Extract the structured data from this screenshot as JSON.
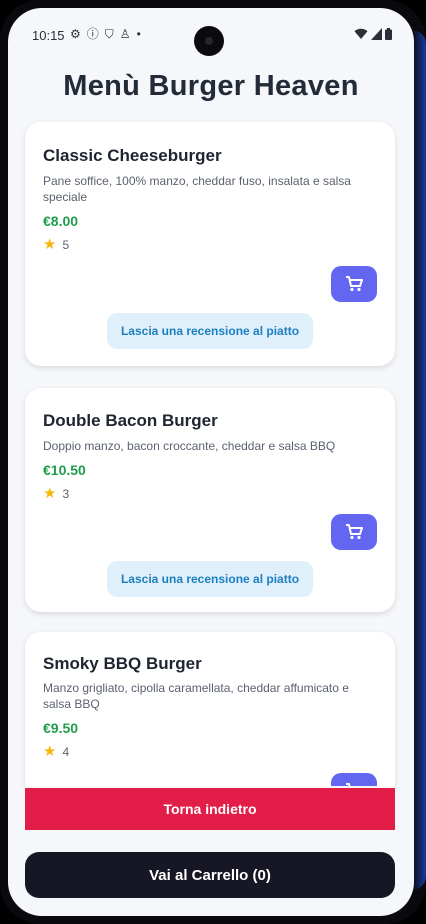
{
  "status_bar": {
    "time": "10:15",
    "left_icons": [
      "settings-icon",
      "info-icon",
      "shield-icon",
      "accessibility-icon",
      "dot-icon"
    ],
    "right_icons": [
      "wifi-icon",
      "signal-icon",
      "battery-icon"
    ]
  },
  "header": {
    "title": "Menù Burger Heaven"
  },
  "menu": {
    "items": [
      {
        "name": "Classic Cheeseburger",
        "description": "Pane soffice, 100% manzo, cheddar fuso, insalata e salsa speciale",
        "price": "€8.00",
        "rating": "5",
        "cart_icon": "cart-icon",
        "review_label": "Lascia una recensione al piatto"
      },
      {
        "name": "Double Bacon Burger",
        "description": "Doppio manzo, bacon croccante, cheddar e salsa BBQ",
        "price": "€10.50",
        "rating": "3",
        "cart_icon": "cart-icon",
        "review_label": "Lascia una recensione al piatto"
      },
      {
        "name": "Smoky BBQ Burger",
        "description": "Manzo grigliato, cipolla caramellata, cheddar affumicato e salsa BBQ",
        "price": "€9.50",
        "rating": "4",
        "cart_icon": "cart-icon"
      }
    ]
  },
  "footer": {
    "back_label": "Torna indietro",
    "cart_label": "Vai al Carrello (0)"
  },
  "colors": {
    "accent": "#6366f1",
    "price": "#1f9d4c",
    "back_button": "#e11d48",
    "cart_button": "#161625",
    "review_button_bg": "#e0f0fb",
    "review_button_text": "#1c7fc0"
  }
}
